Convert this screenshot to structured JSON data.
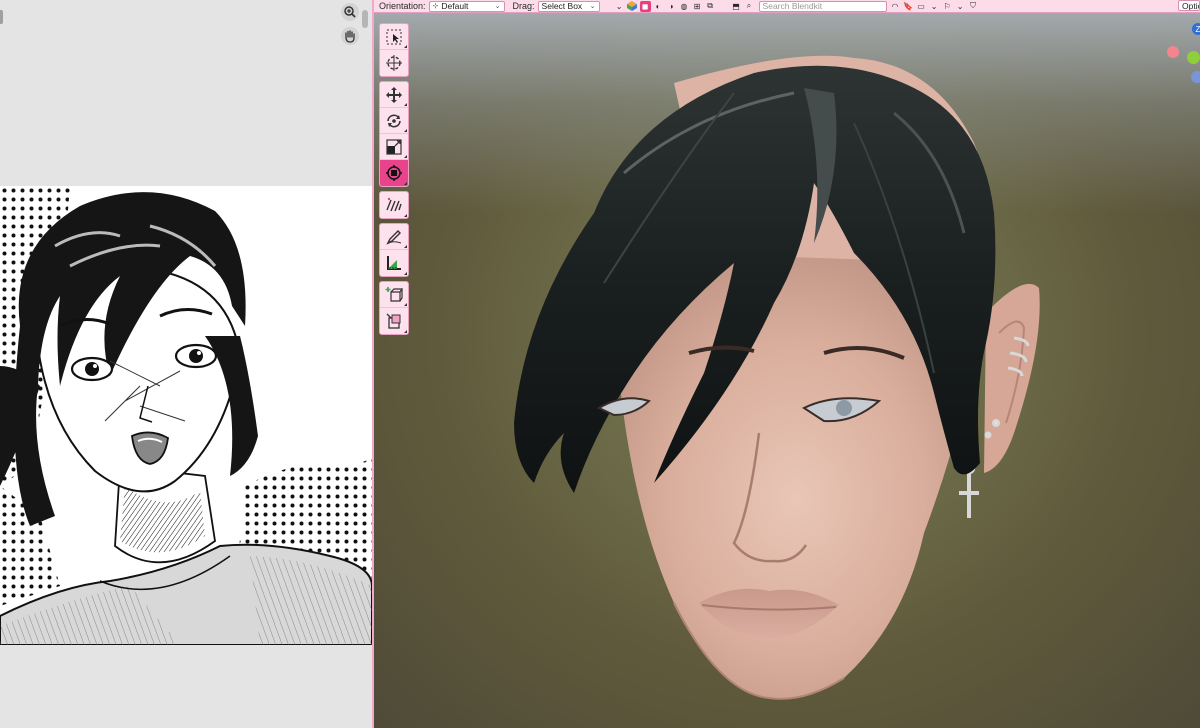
{
  "header": {
    "orientation_label": "Orientation:",
    "orientation_value": "Default",
    "drag_label": "Drag:",
    "drag_value": "Select Box",
    "search_placeholder": "Search Blendkit",
    "options_label": "Options"
  },
  "left_panel": {
    "tools": [
      {
        "name": "zoom-icon"
      },
      {
        "name": "hand-icon"
      }
    ]
  },
  "tool_shelf": {
    "groups": [
      [
        "select-box-tool",
        "cursor-tool"
      ],
      [
        "move-tool",
        "rotate-tool",
        "scale-tool",
        "transform-tool"
      ],
      [
        "annotate-tool"
      ],
      [
        "draw-tool",
        "measure-tool"
      ],
      [
        "add-cube-tool",
        "extrude-tool"
      ]
    ],
    "active_tool": "transform-tool"
  },
  "colors": {
    "accent": "#e9438b",
    "header_bg": "#fbdce8",
    "shelf_bg": "#fde1ec",
    "gizmo_x": "#f4858f",
    "gizmo_y": "#8fcf3e",
    "gizmo_z": "#2e6fd9"
  }
}
